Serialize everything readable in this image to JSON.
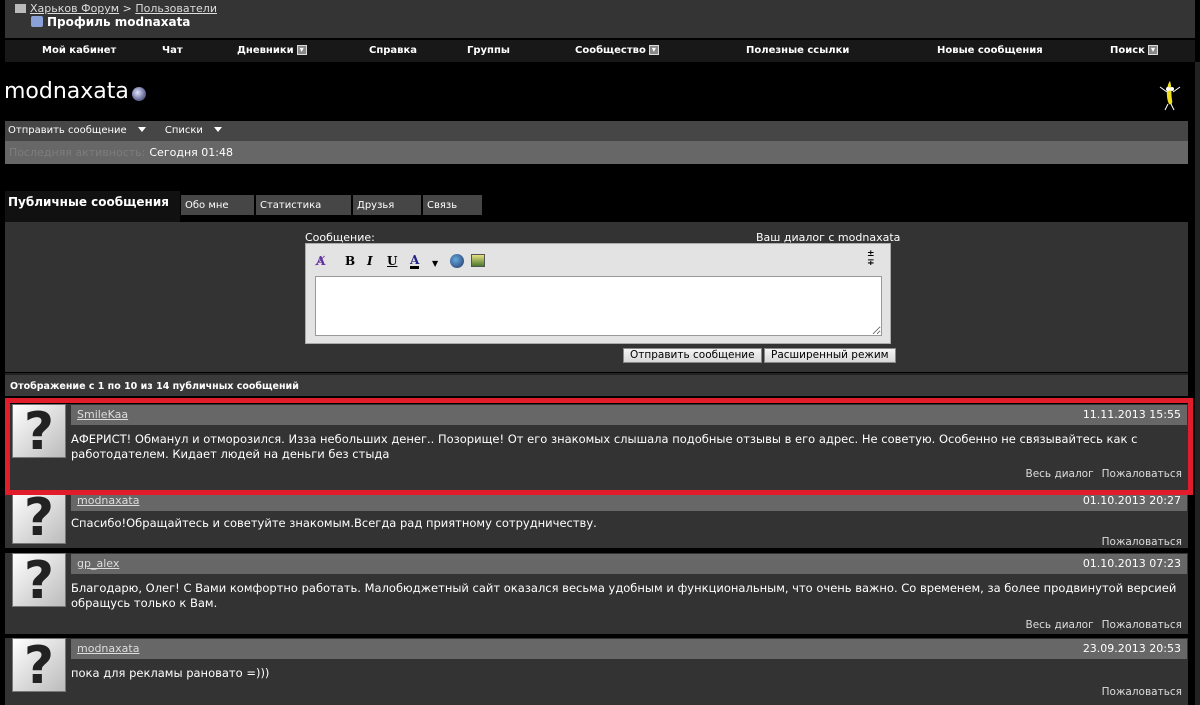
{
  "breadcrumb": {
    "forum": "Харьков Форум",
    "sep": ">",
    "users": "Пользователи"
  },
  "page_title": "Профиль modnaxata",
  "nav": [
    "Мой кабинет",
    "Чат",
    "Дневники",
    "Справка",
    "Группы",
    "Сообщество",
    "Полезные ссылки",
    "Новые сообщения",
    "Поиск"
  ],
  "profile": {
    "username": "modnaxata",
    "actions": {
      "send": "Отправить сообщение",
      "lists": "Списки"
    },
    "last_activity_label": "Последняя активность:",
    "last_activity": "Сегодня 01:48"
  },
  "tabs": [
    "Публичные сообщения",
    "Обо мне",
    "Статистика",
    "Друзья",
    "Связь"
  ],
  "editor": {
    "label": "Сообщение:",
    "dialog_link": "Ваш диалог с modnaxata",
    "bold": "B",
    "italic": "I",
    "underline": "U",
    "color": "A",
    "value": "",
    "send_button": "Отправить сообщение",
    "advanced_button": "Расширенный режим"
  },
  "count_text": "Отображение с 1 по 10 из 14 публичных сообщений",
  "links": {
    "dialog": "Весь диалог",
    "report": "Пожаловаться"
  },
  "messages": [
    {
      "author": "SmileKaa",
      "date": "11.11.2013 15:55",
      "text": "АФЕРИСТ! Обманул и отморозился. Изза небольших денег.. Позорище! От его знакомых слышала подобные отзывы в его адрес. Не советую. Особенно не связывайтесь как с работодателем. Кидает людей на деньги без стыда"
    },
    {
      "author": "modnaxata",
      "date": "01.10.2013 20:27",
      "text": "Спасибо!Обращайтесь и советуйте знакомым.Всегда рад приятному сотрудничеству."
    },
    {
      "author": "gp_alex",
      "date": "01.10.2013 07:23",
      "text": "Благодарю, Олег! С Вами комфортно работать. Малобюджетный сайт оказался весьма удобным и функциональным, что очень важно. Со временем, за более продвинутой версией обращусь только к Вам."
    },
    {
      "author": "modnaxata",
      "date": "23.09.2013 20:53",
      "text": "пока для рекламы рановато =)))"
    }
  ],
  "highlight_color": "#e21d2b"
}
